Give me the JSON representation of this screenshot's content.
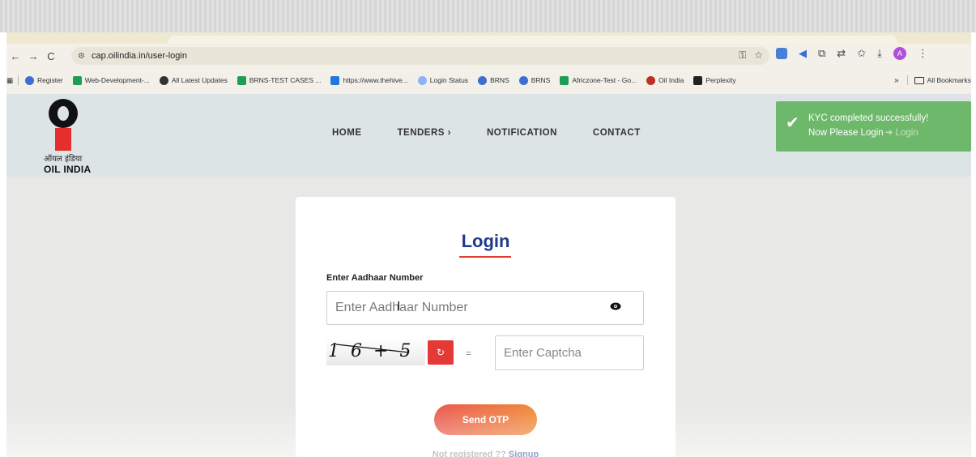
{
  "browser": {
    "url": "cap.oilindia.in/user-login",
    "nav_back": "←",
    "nav_forward": "→",
    "nav_reload": "C",
    "site_info_icon": "⚙",
    "avatar_letter": "A",
    "bookmarks": [
      {
        "label": "Register",
        "icon": "globe"
      },
      {
        "label": "Web-Development-...",
        "icon": "green"
      },
      {
        "label": "All Latest Updates",
        "icon": "dark"
      },
      {
        "label": "BRNS-TEST CASES ...",
        "icon": "green"
      },
      {
        "label": "https://www.thehive...",
        "icon": "blue"
      },
      {
        "label": "Login Status",
        "icon": "g"
      },
      {
        "label": "BRNS",
        "icon": "globe"
      },
      {
        "label": "BRNS",
        "icon": "globe"
      },
      {
        "label": "Africzone-Test - Go...",
        "icon": "green"
      },
      {
        "label": "Oil India",
        "icon": "oil"
      },
      {
        "label": "Perplexity",
        "icon": "perp"
      }
    ],
    "more_bookmarks": "»",
    "all_bookmarks": "All Bookmarks"
  },
  "header": {
    "logo_hindi": "ऑयल इंडिया",
    "logo_text": "OIL INDIA",
    "nav": [
      "HOME",
      "TENDERS ›",
      "NOTIFICATION",
      "CONTACT"
    ]
  },
  "toast": {
    "line1": "KYC completed successfully!",
    "line2": "Now Please Login",
    "ghost": "Login"
  },
  "login": {
    "title": "Login",
    "aadhaar_label": "Enter Aadhaar Number",
    "aadhaar_placeholder": "Enter Aadhaar Number",
    "captcha_text": "16+5",
    "refresh_symbol": "↻",
    "equals": "=",
    "captcha_placeholder": "Enter Captcha",
    "send_otp": "Send OTP",
    "not_registered": "Not registered ?? ",
    "signup": "Signup"
  },
  "colors": {
    "accent_red": "#e53935",
    "title_blue": "#1f3a8a",
    "toast_green": "#6db86a",
    "button_gradient_start": "#ea5a4d",
    "button_gradient_end": "#f08a3a"
  }
}
